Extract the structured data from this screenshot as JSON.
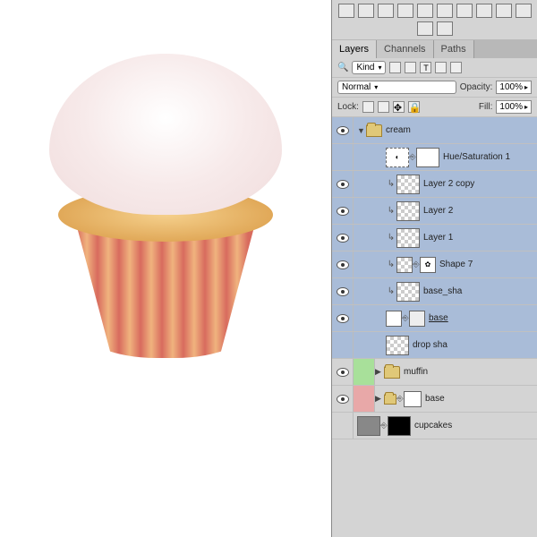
{
  "canvas": {
    "subject": "cupcake-illustration"
  },
  "topIcons": [
    "swatch",
    "balance",
    "gradient",
    "mask",
    "curves",
    "grid",
    "fx1",
    "fx2",
    "fx3",
    "fx4",
    "fx5"
  ],
  "tabs": [
    {
      "label": "Layers",
      "active": true
    },
    {
      "label": "Channels",
      "active": false
    },
    {
      "label": "Paths",
      "active": false
    }
  ],
  "filter": {
    "mode": "Kind",
    "label": "Kind"
  },
  "blend": {
    "mode": "Normal",
    "opacityLabel": "Opacity:",
    "opacity": "100%"
  },
  "lock": {
    "label": "Lock:",
    "fillLabel": "Fill:",
    "fill": "100%"
  },
  "layers": [
    {
      "eye": true,
      "colorchip": "",
      "indent": 0,
      "type": "group-open",
      "name": "cream",
      "sel": true
    },
    {
      "eye": true,
      "colorchip": "",
      "indent": 2,
      "type": "adjust",
      "thumb": "adj",
      "mask": true,
      "name": "Hue/Saturation 1",
      "sel": true
    },
    {
      "eye": true,
      "colorchip": "",
      "indent": 2,
      "type": "clipped",
      "thumb": "checker",
      "name": "Layer 2 copy",
      "sel": true
    },
    {
      "eye": true,
      "colorchip": "",
      "indent": 2,
      "type": "clipped",
      "thumb": "checker",
      "name": "Layer 2",
      "sel": true
    },
    {
      "eye": true,
      "colorchip": "",
      "indent": 2,
      "type": "clipped",
      "thumb": "checker",
      "name": "Layer 1",
      "sel": true
    },
    {
      "eye": true,
      "colorchip": "",
      "indent": 2,
      "type": "clipped-shape",
      "thumb": "checker",
      "link": true,
      "mask": true,
      "vector": true,
      "name": "Shape 7",
      "sel": true
    },
    {
      "eye": true,
      "colorchip": "",
      "indent": 2,
      "type": "clipped",
      "thumb": "checker",
      "name": "base_sha",
      "sel": true
    },
    {
      "eye": true,
      "colorchip": "",
      "indent": 2,
      "type": "shape",
      "thumb": "white",
      "vector": true,
      "name": "base",
      "underline": true,
      "sel": true
    },
    {
      "eye": false,
      "colorchip": "",
      "indent": 2,
      "type": "layer",
      "thumb": "checker",
      "name": "drop sha",
      "sel": true
    },
    {
      "eye": true,
      "colorchip": "green",
      "indent": 0,
      "type": "group-closed",
      "name": "muffin",
      "sel": false
    },
    {
      "eye": true,
      "colorchip": "red",
      "indent": 0,
      "type": "group-closed-mask",
      "thumb": "folder",
      "mask": true,
      "name": "base",
      "sel": false
    },
    {
      "eye": false,
      "colorchip": "",
      "indent": 0,
      "type": "layer-mask",
      "thumb": "gray",
      "blackmask": true,
      "name": "cupcakes",
      "sel": false
    }
  ]
}
